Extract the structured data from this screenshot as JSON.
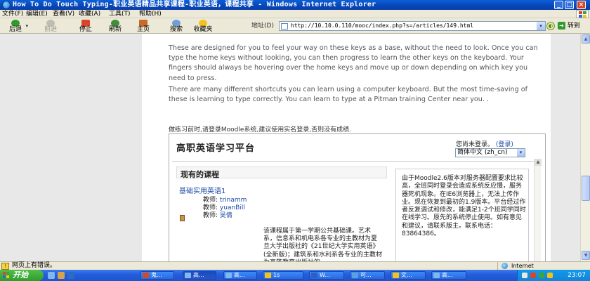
{
  "window": {
    "title": "How To Do Touch Typing-职业英语精品共享课程-职业英语，课程共享 - Windows Internet Explorer"
  },
  "menu": [
    "文件(F)",
    "编辑(E)",
    "查看(V)",
    "收藏(A)",
    "工具(T)",
    "帮助(H)"
  ],
  "toolbar": {
    "back": "后退",
    "forward": "前进",
    "stop": "停止",
    "refresh": "刷新",
    "home": "主页",
    "search": "搜索",
    "favorites": "收藏夹",
    "address_label": "地址(D)",
    "url": "http://10.10.0.110/mooc/index.php?s=/articles/149.html",
    "go": "转到"
  },
  "article": {
    "p1": "These are designed for you to feel your way on these keys as a base, without the need to look. Once you can type the home keys without looking, you can then progress to learn the other keys on the keyboard. Your fingers should always be hovering over the home keys and move up or down depending on which key you need to press.",
    "p2": "There are many different shortcuts you can learn using a computer keyboard. But the most time-saving of these is learning to type correctly. You can learn to type at a Pitman training Center near you. .",
    "note": "做练习前时,请登录Moodle系统,建议使用实名登录,否则没有成绩."
  },
  "moodle": {
    "site_title": "高职英语学习平台",
    "login_text": "您尚未登录。",
    "login_link": "(登录)",
    "language": "简体中文 (zh_cn)",
    "courses_heading": "现有的课程",
    "course_name": "基础实用英语1",
    "teachers": [
      {
        "role": "教师:",
        "name": "trinamm"
      },
      {
        "role": "教师:",
        "name": "yuanBill"
      },
      {
        "role": "教师:",
        "name": "吴倩"
      }
    ],
    "summary": "该课程属于第一学期公共基础课。艺术系，信息系和机电系各专业的主教材为夏旦大学出版社的《21世纪大学实用英语》(全新版)；建筑系和水利系各专业的主教材为高等教育出版社的",
    "notice": "由于Moodle2.6版本对服务器配置要求比较高，全班同时登录会造成系统反应慢，服务器死机现象。在IE6浏览器上，无法上传作业。现在恢复到最初的1.9版本。平台经过作者反复调试和修改，能满足1-2个班同学同时在线学习。原先的系统停止使用。如有意见和建议，请联系版主。联系电话：83864386。"
  },
  "statusbar": {
    "message": "网页上有错误。",
    "zone": "Internet"
  },
  "taskbar": {
    "start": "开始",
    "tasks": [
      "鬼...",
      "高...",
      "高...",
      "1s",
      "W...",
      "可...",
      "文...",
      "高..."
    ],
    "clock": "23:07"
  },
  "colors": {
    "titlebar": "#0a5fd8",
    "link": "#1c4aa6",
    "taskbar": "#245edb",
    "start": "#2f9b2b"
  }
}
